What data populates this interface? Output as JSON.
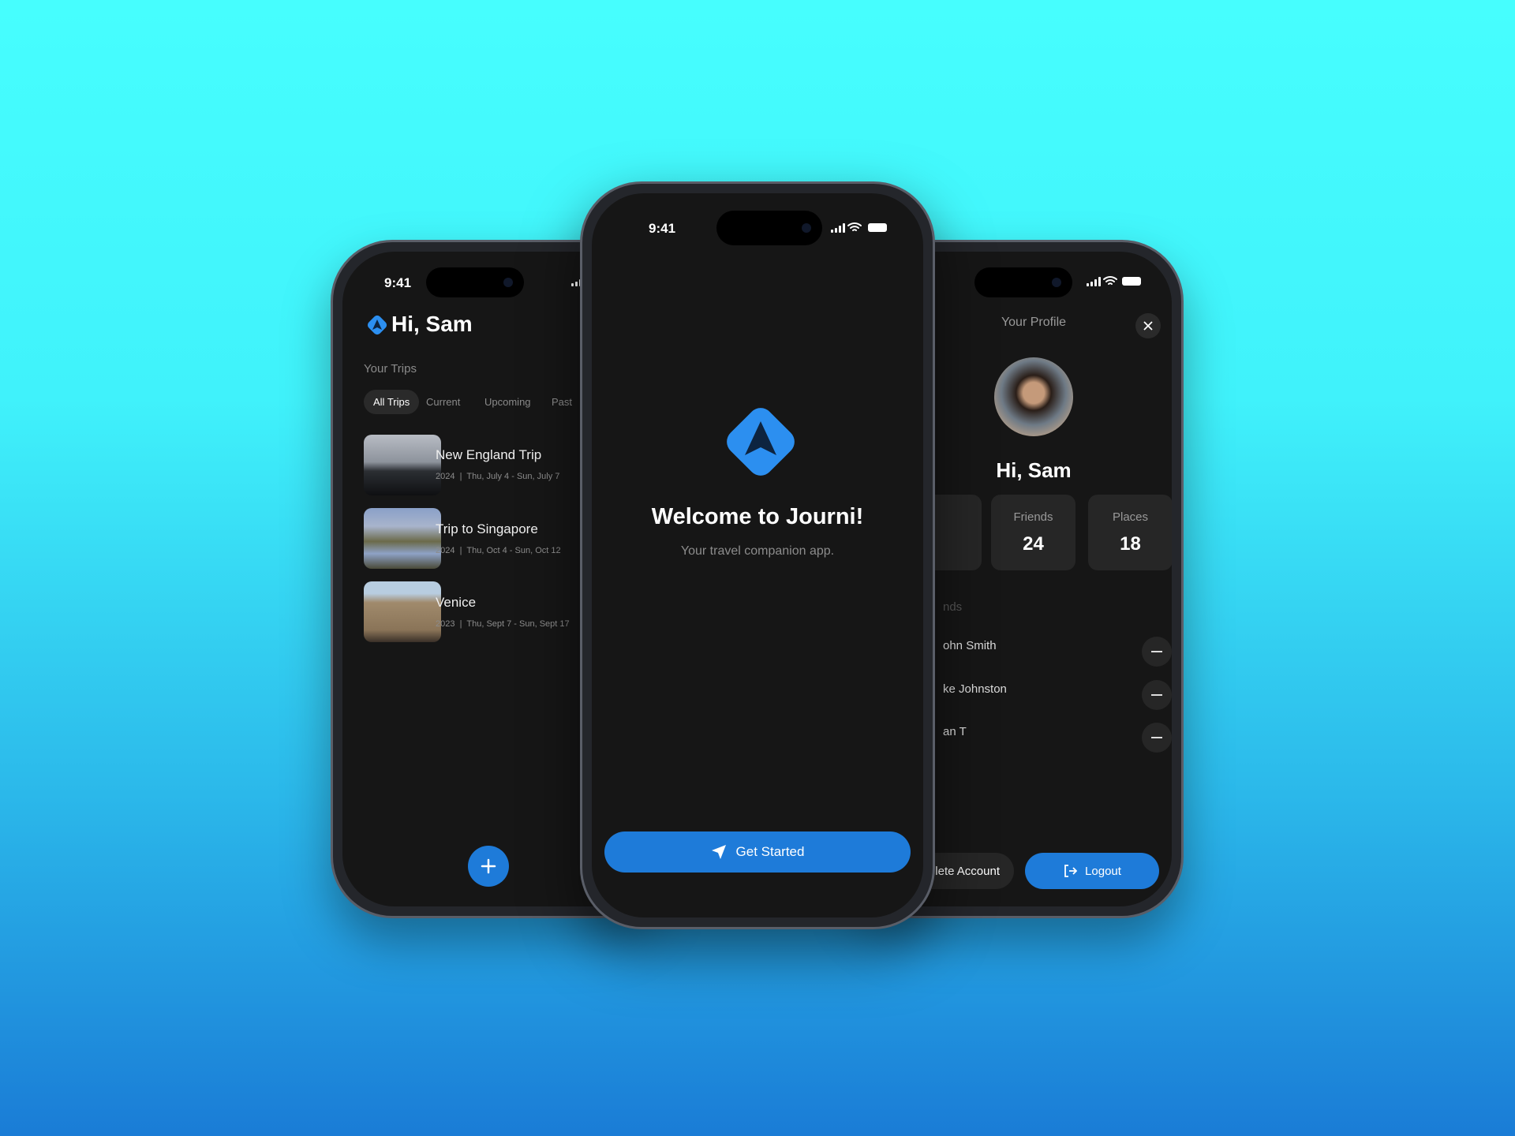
{
  "colors": {
    "accent": "#1e7bd9",
    "screen_bg": "#161616"
  },
  "left_phone": {
    "time": "9:41",
    "greeting": "Hi, Sam",
    "section_label": "Your Trips",
    "tabs": [
      {
        "label": "All Trips",
        "active": true
      },
      {
        "label": "Current"
      },
      {
        "label": "Upcoming"
      },
      {
        "label": "Past"
      }
    ],
    "trips": [
      {
        "title": "New England Trip",
        "year": "2024",
        "dates": "Thu, July 4 - Sun, July 7"
      },
      {
        "title": "Trip to Singapore",
        "year": "2024",
        "dates": "Thu, Oct 4 - Sun, Oct 12"
      },
      {
        "title": "Venice",
        "year": "2023",
        "dates": "Thu, Sept 7 - Sun, Sept 17"
      }
    ],
    "add_icon": "plus-icon"
  },
  "center_phone": {
    "time": "9:41",
    "title": "Welcome to Journi!",
    "subtitle": "Your travel companion app.",
    "cta_label": "Get Started",
    "cta_icon": "navigation-arrow-icon"
  },
  "right_phone": {
    "header": "Your Profile",
    "greeting": "Hi, Sam",
    "stats": [
      {
        "label": "Friends",
        "value": "24"
      },
      {
        "label": "Places",
        "value": "18"
      }
    ],
    "friends_heading": "nds",
    "friends": [
      "ohn Smith",
      "ke Johnston",
      "an T"
    ],
    "delete_label": "lete Account",
    "logout_label": "Logout"
  }
}
